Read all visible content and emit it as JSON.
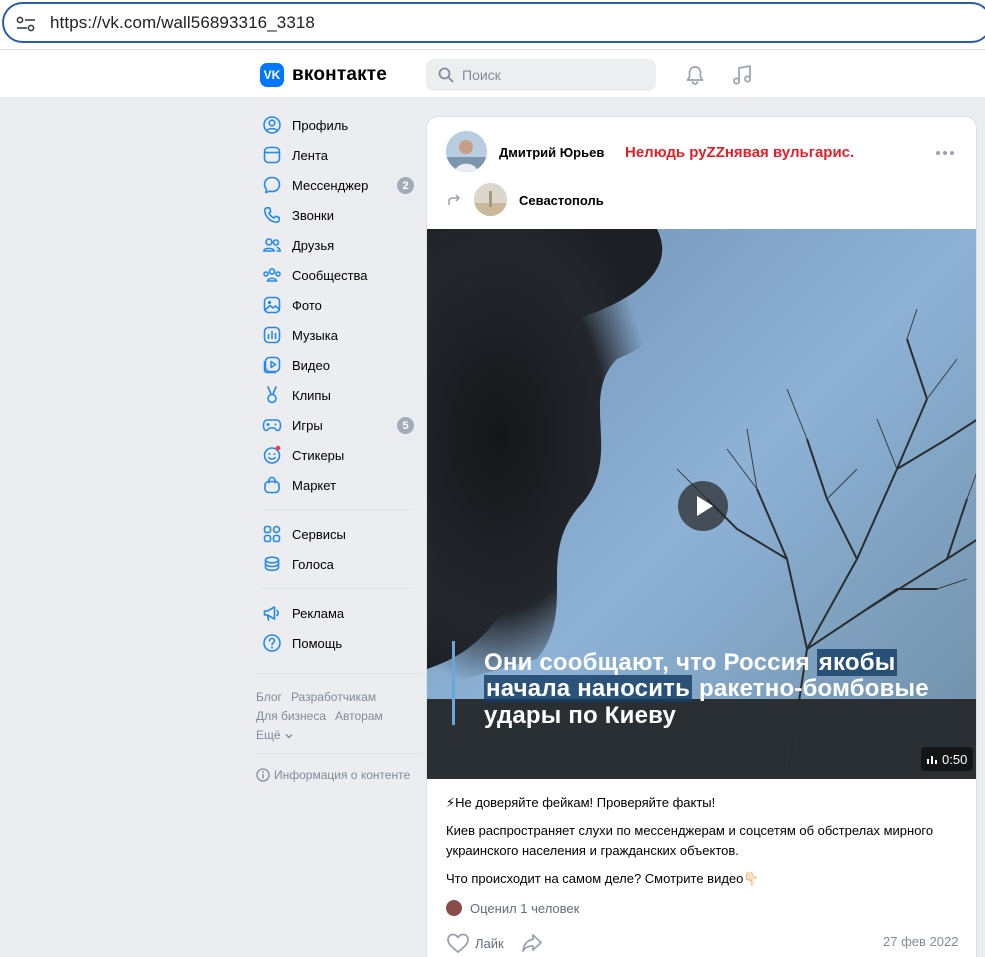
{
  "browser": {
    "url": "https://vk.com/wall56893316_3318"
  },
  "header": {
    "logo_text": "вконтакте",
    "logo_mark": "VK",
    "search_placeholder": "Поиск",
    "icons": [
      "bell-icon",
      "music-icon"
    ]
  },
  "sidebar": {
    "items": [
      {
        "label": "Профиль",
        "icon": "profile-icon"
      },
      {
        "label": "Лента",
        "icon": "feed-icon"
      },
      {
        "label": "Мессенджер",
        "icon": "messenger-icon",
        "badge": "2"
      },
      {
        "label": "Звонки",
        "icon": "phone-icon"
      },
      {
        "label": "Друзья",
        "icon": "friends-icon"
      },
      {
        "label": "Сообщества",
        "icon": "communities-icon"
      },
      {
        "label": "Фото",
        "icon": "photo-icon"
      },
      {
        "label": "Музыка",
        "icon": "music-icon"
      },
      {
        "label": "Видео",
        "icon": "video-icon"
      },
      {
        "label": "Клипы",
        "icon": "clips-icon"
      },
      {
        "label": "Игры",
        "icon": "games-icon",
        "badge": "5"
      },
      {
        "label": "Стикеры",
        "icon": "stickers-icon"
      },
      {
        "label": "Маркет",
        "icon": "market-icon"
      }
    ],
    "group2": [
      {
        "label": "Сервисы",
        "icon": "services-icon"
      },
      {
        "label": "Голоса",
        "icon": "votes-icon"
      }
    ],
    "group3": [
      {
        "label": "Реклама",
        "icon": "ads-icon"
      },
      {
        "label": "Помощь",
        "icon": "help-icon"
      }
    ],
    "footer_links": {
      "blog": "Блог",
      "developers": "Разработчикам",
      "business": "Для бизнеса",
      "authors": "Авторам",
      "more": "Ещё"
    },
    "info": "Информация о контенте"
  },
  "post": {
    "author": "Дмитрий Юрьев",
    "annotation": "Нелюдь руZZнявая вульгарис.",
    "source": "Севастополь",
    "video": {
      "caption_line1_a": "Они сообщают, что Россия ",
      "caption_line1_b": "якобы",
      "caption_line2_a": "начала наносить",
      "caption_line2_b": " ракетно-бомбовые",
      "caption_line3": "удары по Киеву",
      "duration": "0:50"
    },
    "text_line1": "⚡Не доверяйте фейкам! Проверяйте факты!",
    "text_para2": "Киев распространяет слухи по мессенджерам и соцсетям об обстрелах мирного украинского населения и гражданских объектов.",
    "text_para3": "Что происходит на самом деле? Смотрите видео👇🏻",
    "rated": "Оценил 1 человек",
    "like_label": "Лайк",
    "date": "27 фев 2022"
  },
  "colors": {
    "accent": "#0077ff",
    "annotation_red": "#e0202a",
    "url_border": "#2a5fa8"
  }
}
